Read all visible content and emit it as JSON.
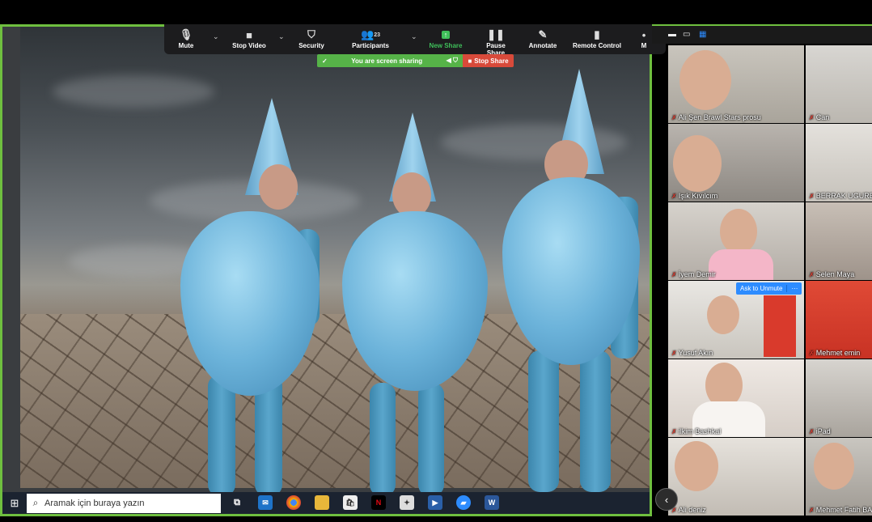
{
  "toolbar": {
    "items": [
      {
        "label": "Mute",
        "icon": "microphone-icon"
      },
      {
        "label": "Stop Video",
        "icon": "video-camera-icon"
      },
      {
        "label": "Security",
        "icon": "shield-icon"
      },
      {
        "label": "Participants",
        "icon": "participants-icon",
        "count": "23"
      },
      {
        "label": "New Share",
        "icon": "share-arrow-icon"
      },
      {
        "label": "Pause Share",
        "icon": "pause-icon"
      },
      {
        "label": "Annotate",
        "icon": "pen-icon"
      },
      {
        "label": "Remote Control",
        "icon": "mouse-icon"
      },
      {
        "label": "M",
        "icon": "more-icon"
      }
    ],
    "colors": {
      "new_share": "#3fbf5a",
      "bar": "#1c1c1e"
    }
  },
  "share_bar": {
    "status_text": "You are screen sharing",
    "stop_label": "Stop Share",
    "colors": {
      "status": "#56b348",
      "stop": "#d84a3a"
    }
  },
  "taskbar": {
    "search_placeholder": "Aramak için buraya yazın",
    "apps": [
      "task-view-icon",
      "mail-icon",
      "chrome-icon",
      "file-explorer-icon",
      "store-icon",
      "netflix-icon",
      "app-icon",
      "media-player-icon",
      "zoom-icon",
      "word-icon"
    ]
  },
  "gallery": {
    "view_icons": [
      "minimize-icon",
      "speaker-view-icon",
      "gallery-view-icon"
    ],
    "participants": [
      {
        "name": "Ali Şen Brawl Stars prosu"
      },
      {
        "name": "Can"
      },
      {
        "name": "Işık Kıvılcım"
      },
      {
        "name": "BERRAK UGURER"
      },
      {
        "name": "İyem Demir"
      },
      {
        "name": "Selen Maya"
      },
      {
        "name": "Yusuf Akın"
      },
      {
        "name": "Mehmet emin"
      },
      {
        "name": "ilkim Bashkal"
      },
      {
        "name": "iPad"
      },
      {
        "name": "Ali deniz"
      },
      {
        "name": "Mehmet Fatih BA"
      }
    ],
    "ask_to_unmute": "Ask to Unmute",
    "more_label": "···"
  },
  "accent_color": "#6fbf3f"
}
